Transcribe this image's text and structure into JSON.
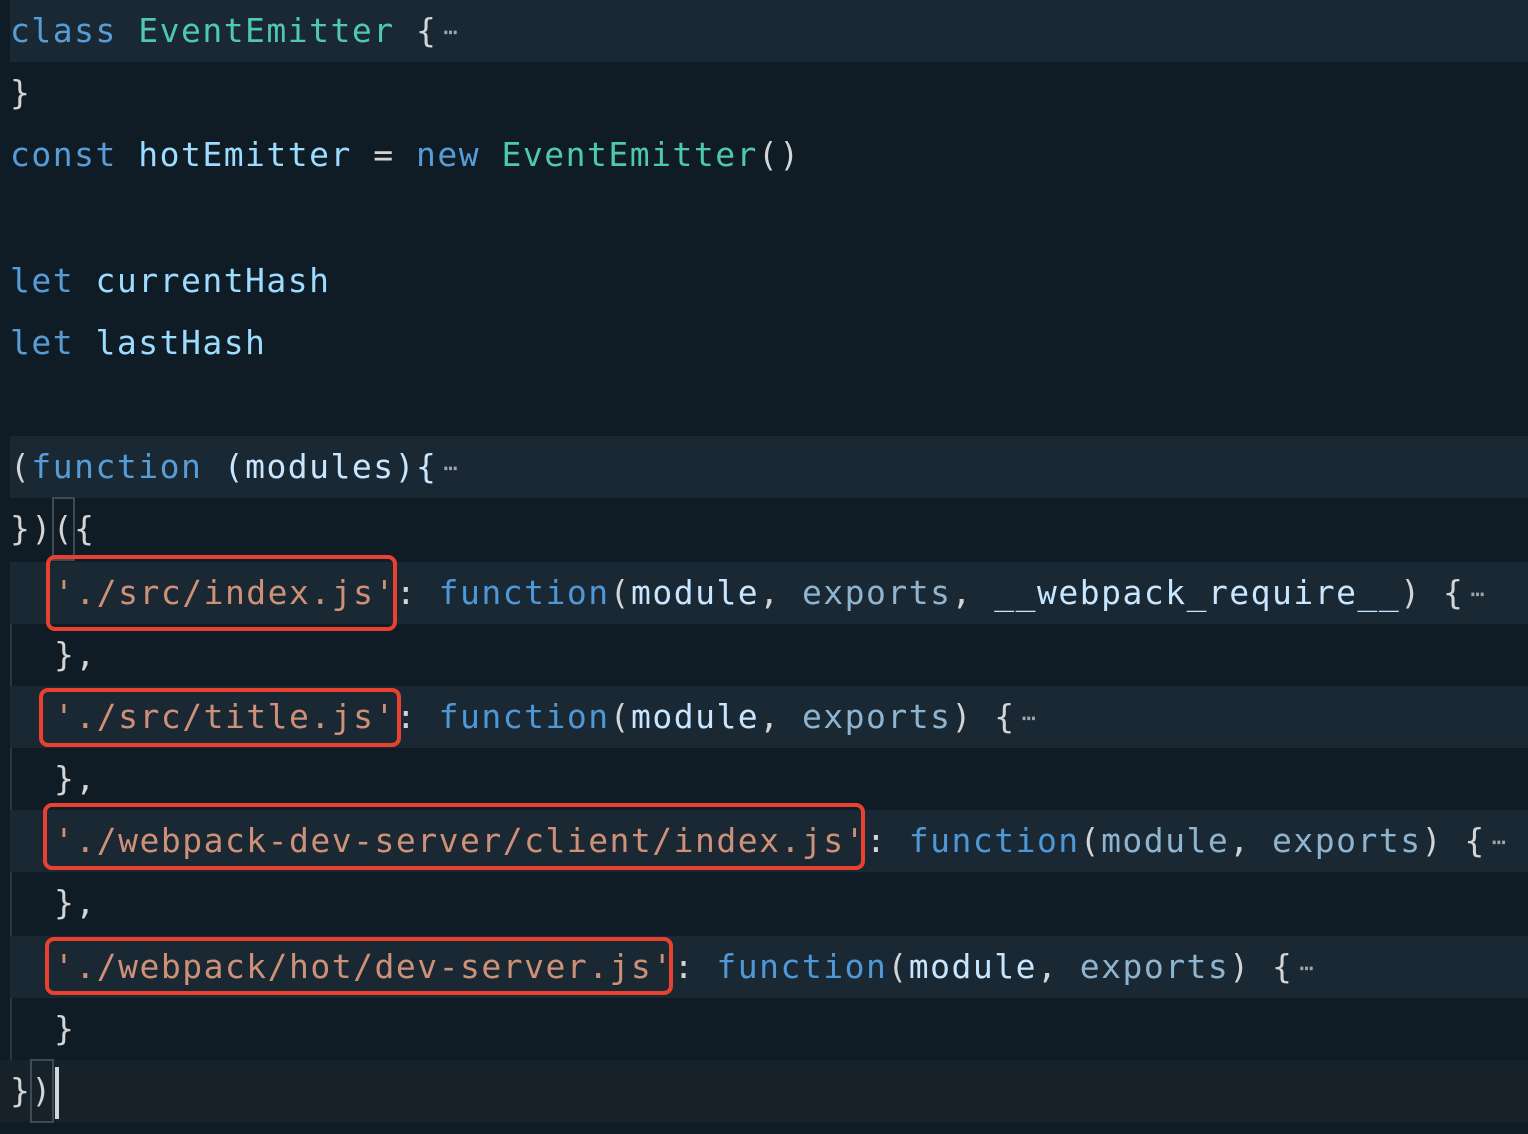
{
  "editor": {
    "colors": {
      "background": "#101c25",
      "folded_line": "#1a2834",
      "keyword": "#569cd6",
      "class_name": "#4ec9b0",
      "variable": "#9cdcfe",
      "parameter": "#8fb4cf",
      "string": "#ce9178",
      "highlight_box": "#e8412f"
    },
    "lines": [
      {
        "keyword": "class",
        "name": "EventEmitter",
        "brace": "{",
        "fold_icon": "⋯"
      },
      {
        "text": "}"
      },
      {
        "keyword": "const",
        "variable": "hotEmitter",
        "operator": "=",
        "new_keyword": "new",
        "class_name": "EventEmitter",
        "parens": "()"
      },
      {
        "keyword": "let",
        "variable": "currentHash"
      },
      {
        "keyword": "let",
        "variable": "lastHash"
      },
      {
        "open_paren": "(",
        "keyword": "function",
        "param": "(modules){",
        "fold_icon": "⋯"
      },
      {
        "close": "})",
        "open_paren": "(",
        "brace": "{"
      },
      {
        "key": "'./src/index.js'",
        "colon": ":",
        "keyword": "function",
        "open": "(",
        "param1": "module",
        "comma1": ", ",
        "param2": "exports",
        "comma2": ", ",
        "param3": "__webpack_require__",
        "close": ") {",
        "fold_icon": "⋯"
      },
      {
        "text": "},"
      },
      {
        "key": "'./src/title.js'",
        "colon": ":",
        "keyword": "function",
        "open": "(",
        "param1": "module",
        "comma1": ", ",
        "param2": "exports",
        "close": ") {",
        "fold_icon": "⋯"
      },
      {
        "text": "},"
      },
      {
        "key": "'./webpack-dev-server/client/index.js'",
        "colon": ":",
        "keyword": "function",
        "open": "(",
        "param1": "module",
        "comma1": ", ",
        "param2": "exports",
        "close": ") {",
        "fold_icon": "⋯"
      },
      {
        "text": "},"
      },
      {
        "key": "'./webpack/hot/dev-server.js'",
        "colon": ":",
        "keyword": "function",
        "open": "(",
        "param1": "module",
        "comma1": ", ",
        "param2": "exports",
        "close": ") {",
        "fold_icon": "⋯"
      },
      {
        "text": "}"
      },
      {
        "close_brace": "}",
        "close_paren": ")"
      }
    ]
  }
}
